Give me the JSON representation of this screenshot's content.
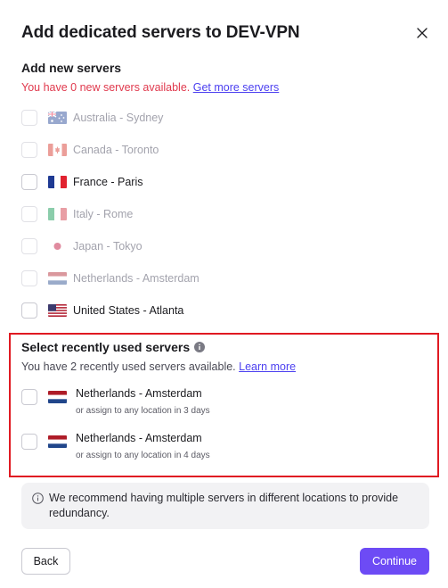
{
  "dialog": {
    "title": "Add dedicated servers to DEV-VPN",
    "close_icon": "close-icon"
  },
  "new_servers": {
    "heading": "Add new servers",
    "availability_text": "You have 0 new servers available.",
    "availability_link": "Get more servers",
    "items": [
      {
        "label": "Australia - Sydney",
        "flag": "australia-flag",
        "enabled": false
      },
      {
        "label": "Canada - Toronto",
        "flag": "canada-flag",
        "enabled": false
      },
      {
        "label": "France - Paris",
        "flag": "france-flag",
        "enabled": true
      },
      {
        "label": "Italy - Rome",
        "flag": "italy-flag",
        "enabled": false
      },
      {
        "label": "Japan - Tokyo",
        "flag": "japan-flag",
        "enabled": false
      },
      {
        "label": "Netherlands - Amsterdam",
        "flag": "netherlands-flag",
        "enabled": false
      },
      {
        "label": "United States - Atlanta",
        "flag": "us-flag",
        "enabled": true
      }
    ]
  },
  "recent_servers": {
    "heading": "Select recently used servers",
    "availability_text": "You have 2 recently used servers available.",
    "availability_link": "Learn more",
    "items": [
      {
        "label": "Netherlands - Amsterdam",
        "subtitle": "or assign to any location in 3 days",
        "flag": "netherlands-flag"
      },
      {
        "label": "Netherlands - Amsterdam",
        "subtitle": "or assign to any location in 4 days",
        "flag": "netherlands-flag"
      }
    ]
  },
  "notice": {
    "text": "We recommend having multiple servers in different locations to provide redundancy."
  },
  "footer": {
    "back_label": "Back",
    "continue_label": "Continue"
  },
  "colors": {
    "accent": "#6d4bf5",
    "link": "#4b3ff0",
    "warning_text": "#e0394d",
    "highlight_border": "#e01a22"
  }
}
